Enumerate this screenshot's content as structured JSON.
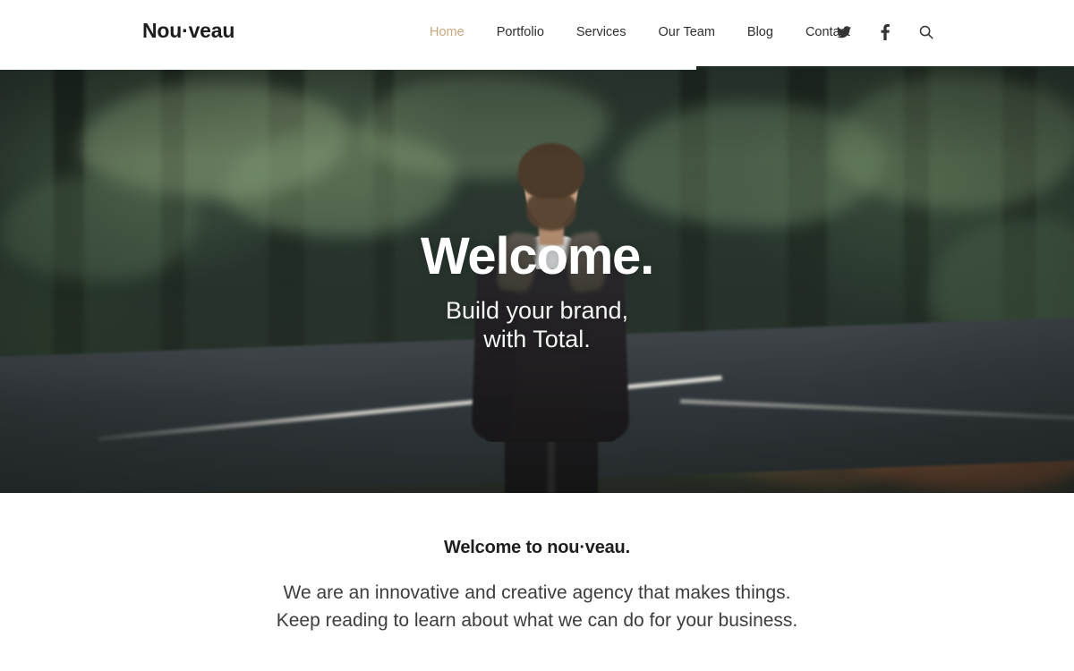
{
  "site": {
    "logo": "Nou·veau"
  },
  "nav": {
    "items": [
      {
        "label": "Home",
        "active": true,
        "name": "nav-item-home"
      },
      {
        "label": "Portfolio",
        "active": false,
        "name": "nav-item-portfolio"
      },
      {
        "label": "Services",
        "active": false,
        "name": "nav-item-services"
      },
      {
        "label": "Our Team",
        "active": false,
        "name": "nav-item-our-team"
      },
      {
        "label": "Blog",
        "active": false,
        "name": "nav-item-blog"
      },
      {
        "label": "Contact",
        "active": false,
        "name": "nav-item-contact"
      }
    ],
    "active_color": "#c9a87c",
    "text_color": "#2f2f2f"
  },
  "header_icons": [
    {
      "icon": "twitter-icon",
      "label": "Twitter"
    },
    {
      "icon": "facebook-icon",
      "label": "Facebook"
    },
    {
      "icon": "search-icon",
      "label": "Search"
    }
  ],
  "hero": {
    "title": "Welcome.",
    "subtitle_line1": "Build your brand,",
    "subtitle_line2": "with Total.",
    "image_description": "Bearded man in black leather jacket standing on a forest road",
    "text_color": "#ffffff"
  },
  "intro": {
    "title": "Welcome to nou·veau.",
    "body_line1": "We are an innovative and creative agency that makes things. Keep",
    "body_line2": "reading to learn about what we can do for your business."
  }
}
